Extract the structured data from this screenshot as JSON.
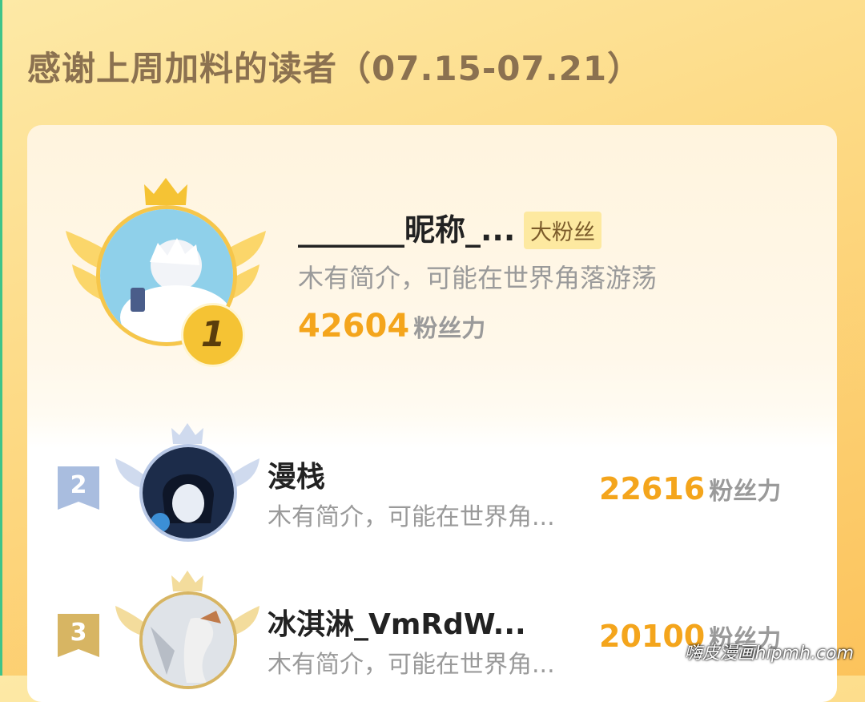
{
  "header": {
    "title": "感谢上周加料的读者（07.15-07.21）"
  },
  "top_reader": {
    "rank": "1",
    "name": "_______昵称_...",
    "badge": "大粉丝",
    "bio": "木有简介，可能在世界角落游荡",
    "score": "42604",
    "score_unit": "粉丝力"
  },
  "readers": [
    {
      "rank": "2",
      "name": "漫栈",
      "bio": "木有简介，可能在世界角...",
      "score": "22616",
      "score_unit": "粉丝力"
    },
    {
      "rank": "3",
      "name": "冰淇淋_VmRdW...",
      "bio": "木有简介，可能在世界角...",
      "score": "20100",
      "score_unit": "粉丝力"
    }
  ],
  "watermark": "嗨皮漫画hipmh.com",
  "colors": {
    "accent_score": "#f4a51c",
    "gold": "#f5c334",
    "silver": "#b8c8e6",
    "bronze": "#d7b563"
  }
}
